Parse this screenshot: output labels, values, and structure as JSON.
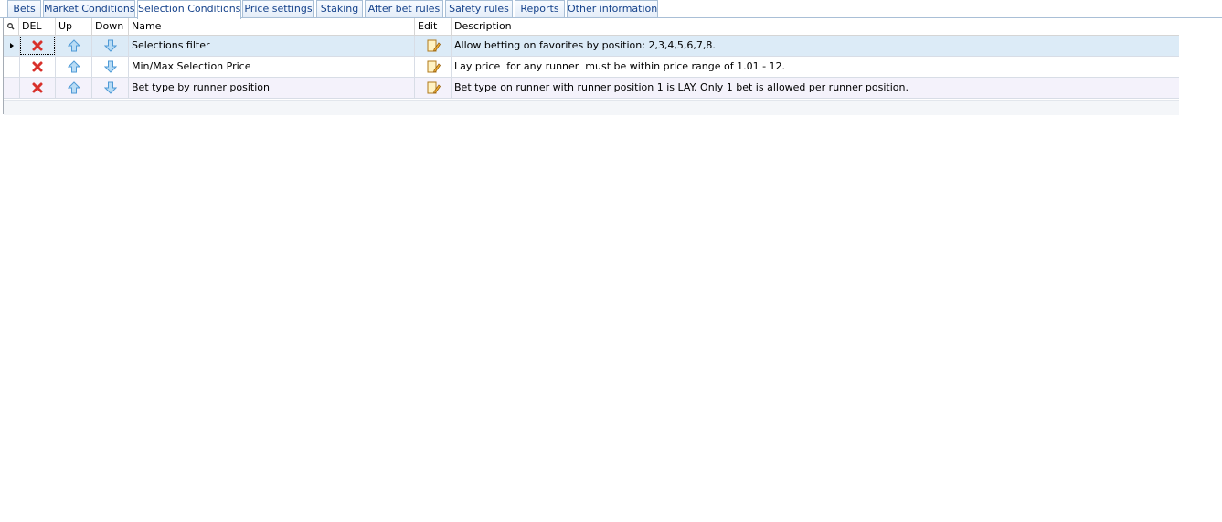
{
  "tabs": [
    {
      "label": "Bets"
    },
    {
      "label": "Market Conditions"
    },
    {
      "label": "Selection Conditions",
      "active": true
    },
    {
      "label": "Price settings"
    },
    {
      "label": "Staking"
    },
    {
      "label": "After bet rules"
    },
    {
      "label": "Safety rules"
    },
    {
      "label": "Reports"
    },
    {
      "label": "Other information"
    }
  ],
  "grid": {
    "columns": {
      "del": "DEL",
      "up": "Up",
      "down": "Down",
      "name": "Name",
      "edit": "Edit",
      "description": "Description"
    },
    "rows": [
      {
        "name": "Selections filter",
        "description": "Allow betting on favorites by position: 2,3,4,5,6,7,8.",
        "selected": true
      },
      {
        "name": "Min/Max Selection Price",
        "description": "Lay price  for any runner  must be within price range of 1.01 - 12."
      },
      {
        "name": "Bet type by runner position",
        "description": "Bet type on runner with runner position 1 is LAY. Only 1 bet is allowed per runner position."
      }
    ],
    "icons": {
      "filter": "search-icon",
      "delete": "delete-x-icon",
      "up": "arrow-up-icon",
      "down": "arrow-down-icon",
      "edit": "edit-icon",
      "row_pointer": "current-row-triangle-icon"
    },
    "colors": {
      "selected_row": "#dcebf7",
      "alt_row": "#f4f2fb",
      "delete_icon": "#d8312b",
      "arrow_icon": "#4f9ad6",
      "tab_text": "#15428b"
    }
  }
}
